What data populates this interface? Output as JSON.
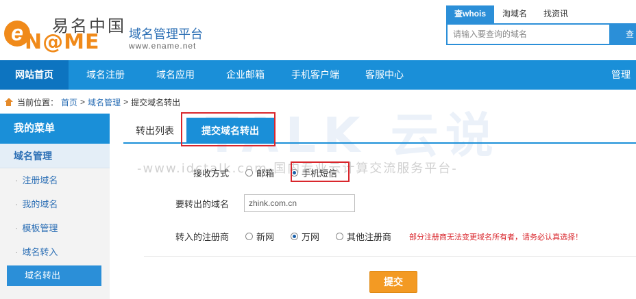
{
  "header": {
    "logo_cn": "易名中国",
    "logo_en": "N@ME",
    "logo_e": "e",
    "platform_title": "域名管理平台",
    "platform_url": "www.ename.net"
  },
  "search": {
    "tabs": [
      "查whois",
      "淘域名",
      "找资讯"
    ],
    "placeholder": "请输入要查询的域名",
    "button": "查"
  },
  "nav": {
    "home": "网站首页",
    "items": [
      "域名注册",
      "域名应用",
      "企业邮箱",
      "手机客户端",
      "客服中心"
    ],
    "right": "管理中"
  },
  "breadcrumb": {
    "prefix": "当前位置：",
    "home": "首页",
    "sep1": ">",
    "section": "域名管理",
    "sep2": ">",
    "current": "提交域名转出"
  },
  "sidebar": {
    "head": "我的菜单",
    "section": "域名管理",
    "items": [
      "注册域名",
      "我的域名",
      "模板管理",
      "域名转入"
    ],
    "active": "域名转出",
    "bullet": "·"
  },
  "tabs": {
    "list": "转出列表",
    "submit": "提交域名转出"
  },
  "watermark": {
    "big": "TALK 云说",
    "small": "-www.idctalk.com-国内专业云计算交流服务平台-"
  },
  "form": {
    "receive_label": "接收方式",
    "receive_options": [
      "邮箱",
      "手机短信"
    ],
    "domain_label": "要转出的域名",
    "domain_value": "zhink.com.cn",
    "registrar_label": "转入的注册商",
    "registrar_options": [
      "新网",
      "万网",
      "其他注册商"
    ],
    "warning": "部分注册商无法变更域名所有者，请务必认真选择！",
    "submit": "提交"
  },
  "colors": {
    "primary": "#1a8fd8",
    "accent": "#f39a23",
    "highlight": "#d9262c"
  }
}
